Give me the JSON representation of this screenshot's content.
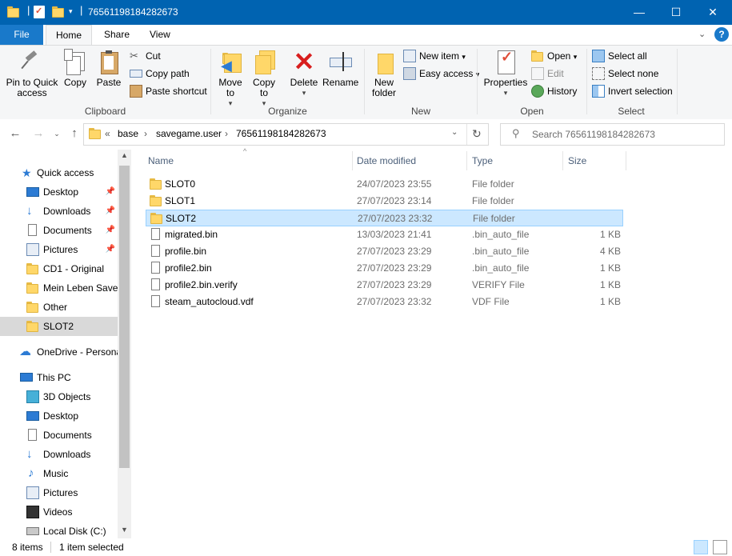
{
  "window": {
    "title": "76561198184282673",
    "minimize": "—",
    "maximize": "☐",
    "close": "✕"
  },
  "ribbon_tabs": [
    "File",
    "Home",
    "Share",
    "View"
  ],
  "ribbon": {
    "clipboard": {
      "label": "Clipboard",
      "pin": "Pin to Quick access",
      "copy": "Copy",
      "paste": "Paste",
      "cut": "Cut",
      "copy_path": "Copy path",
      "paste_shortcut": "Paste shortcut"
    },
    "organize": {
      "label": "Organize",
      "move_to": "Move to",
      "copy_to": "Copy to",
      "delete": "Delete",
      "rename": "Rename"
    },
    "new": {
      "label": "New",
      "new_folder": "New folder",
      "new_item": "New item",
      "easy_access": "Easy access"
    },
    "open": {
      "label": "Open",
      "properties": "Properties",
      "open": "Open",
      "edit": "Edit",
      "history": "History"
    },
    "select": {
      "label": "Select",
      "select_all": "Select all",
      "select_none": "Select none",
      "invert_selection": "Invert selection"
    }
  },
  "address": {
    "overflow": "«",
    "crumbs": [
      "base",
      "savegame.user",
      "76561198184282673"
    ],
    "separator": "›",
    "search_placeholder": "Search 76561198184282673"
  },
  "nav": {
    "quick_access": "Quick access",
    "quick_items": [
      "Desktop",
      "Downloads",
      "Documents",
      "Pictures",
      "CD1 - Original",
      "Mein Leben Save",
      "Other",
      "SLOT2"
    ],
    "onedrive": "OneDrive - Persona",
    "this_pc": "This PC",
    "pc_items": [
      "3D Objects",
      "Desktop",
      "Documents",
      "Downloads",
      "Music",
      "Pictures",
      "Videos",
      "Local Disk (C:)"
    ]
  },
  "columns": {
    "name": "Name",
    "date": "Date modified",
    "type": "Type",
    "size": "Size"
  },
  "files": [
    {
      "name": "SLOT0",
      "date": "24/07/2023 23:55",
      "type": "File folder",
      "size": "",
      "kind": "folder"
    },
    {
      "name": "SLOT1",
      "date": "27/07/2023 23:14",
      "type": "File folder",
      "size": "",
      "kind": "folder"
    },
    {
      "name": "SLOT2",
      "date": "27/07/2023 23:32",
      "type": "File folder",
      "size": "",
      "kind": "folder",
      "selected": true
    },
    {
      "name": "migrated.bin",
      "date": "13/03/2023 21:41",
      "type": ".bin_auto_file",
      "size": "1 KB",
      "kind": "file"
    },
    {
      "name": "profile.bin",
      "date": "27/07/2023 23:29",
      "type": ".bin_auto_file",
      "size": "4 KB",
      "kind": "file"
    },
    {
      "name": "profile2.bin",
      "date": "27/07/2023 23:29",
      "type": ".bin_auto_file",
      "size": "1 KB",
      "kind": "file"
    },
    {
      "name": "profile2.bin.verify",
      "date": "27/07/2023 23:29",
      "type": "VERIFY File",
      "size": "1 KB",
      "kind": "file"
    },
    {
      "name": "steam_autocloud.vdf",
      "date": "27/07/2023 23:32",
      "type": "VDF File",
      "size": "1 KB",
      "kind": "file"
    }
  ],
  "status": {
    "count": "8 items",
    "selection": "1 item selected"
  },
  "colors": {
    "titlebar": "#0063b1",
    "file_tab": "#1979ca",
    "selection": "#cce8ff"
  }
}
